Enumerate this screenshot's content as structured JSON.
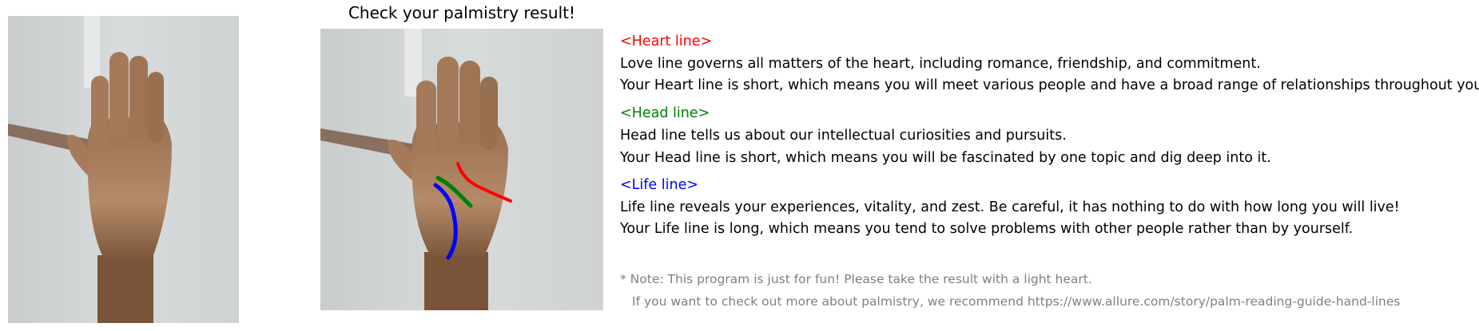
{
  "title": "Check your palmistry result!",
  "colors": {
    "heart": "#ff0000",
    "head": "#008000",
    "life": "#0000ff",
    "text": "#000000",
    "note": "#808080"
  },
  "sections": {
    "heart": {
      "heading": "<Heart line>",
      "description": "Love line governs all matters of the heart, including romance, friendship, and commitment.",
      "result": "Your Heart line is short, which means you will meet various people and have a broad range of relationships throughout your life."
    },
    "head": {
      "heading": "<Head line>",
      "description": "Head line tells us about our intellectual curiosities and pursuits.",
      "result": "Your Head line is short, which means you will be fascinated by one topic and dig deep into it."
    },
    "life": {
      "heading": "<Life line>",
      "description": "Life line reveals your experiences, vitality, and zest. Be careful, it has nothing to do with how long you will live!",
      "result": "Your Life line is long, which means you tend to solve problems with other people rather than by yourself."
    }
  },
  "note": {
    "line1": "* Note: This program is just for fun! Please take the result with a light heart.",
    "line2": "If you want to check out more about palmistry, we recommend https://www.allure.com/story/palm-reading-guide-hand-lines"
  }
}
